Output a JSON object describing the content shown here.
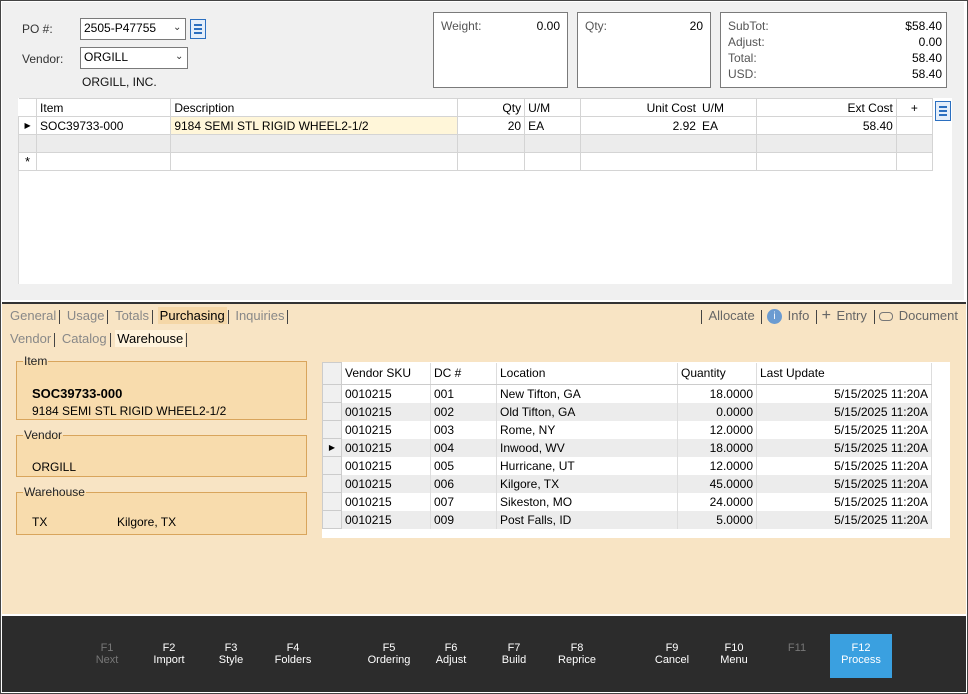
{
  "header": {
    "po_label": "PO #:",
    "po_value": "2505-P47755",
    "vendor_label": "Vendor:",
    "vendor_value": "ORGILL",
    "vendor_name": "ORGILL, INC."
  },
  "summary": {
    "weight_label": "Weight:",
    "weight_value": "0.00",
    "qty_label": "Qty:",
    "qty_value": "20",
    "subtot_label": "SubTot:",
    "subtot_value": "$58.40",
    "adjust_label": "Adjust:",
    "adjust_value": "0.00",
    "total_label": "Total:",
    "total_value": "58.40",
    "usd_label": "USD:",
    "usd_value": "58.40"
  },
  "lines": {
    "columns": [
      "Item",
      "Description",
      "Qty",
      "U/M",
      "Unit Cost",
      "U/M",
      "Ext Cost",
      "+"
    ],
    "rows": [
      {
        "item": "SOC39733-000",
        "description": "9184 SEMI STL RIGID WHEEL2-1/2",
        "qty": "20",
        "um": "EA",
        "unit_cost": "2.92",
        "um2": "EA",
        "ext_cost": "58.40"
      }
    ],
    "new_row_marker": "*"
  },
  "tabs": {
    "main": [
      "General",
      "Usage",
      "Totals",
      "Purchasing",
      "Inquiries"
    ],
    "active_main": "Purchasing",
    "actions": [
      "Allocate",
      "Info",
      "Entry",
      "Document"
    ],
    "sub": [
      "Vendor",
      "Catalog",
      "Warehouse"
    ],
    "active_sub": "Warehouse"
  },
  "item_panel": {
    "legend": "Item",
    "code": "SOC39733-000",
    "description": "9184 SEMI STL RIGID WHEEL2-1/2"
  },
  "vendor_panel": {
    "legend": "Vendor",
    "value": "ORGILL"
  },
  "warehouse_panel": {
    "legend": "Warehouse",
    "code": "TX",
    "city": "Kilgore, TX"
  },
  "warehouse_table": {
    "columns": [
      "Vendor SKU",
      "DC #",
      "Location",
      "Quantity",
      "Last Update"
    ],
    "rows": [
      {
        "sku": "0010215",
        "dc": "001",
        "location": "New Tifton, GA",
        "quantity": "18.0000",
        "last_update": "5/15/2025 11:20A"
      },
      {
        "sku": "0010215",
        "dc": "002",
        "location": "Old Tifton, GA",
        "quantity": "0.0000",
        "last_update": "5/15/2025 11:20A"
      },
      {
        "sku": "0010215",
        "dc": "003",
        "location": "Rome, NY",
        "quantity": "12.0000",
        "last_update": "5/15/2025 11:20A"
      },
      {
        "sku": "0010215",
        "dc": "004",
        "location": "Inwood, WV",
        "quantity": "18.0000",
        "last_update": "5/15/2025 11:20A"
      },
      {
        "sku": "0010215",
        "dc": "005",
        "location": "Hurricane, UT",
        "quantity": "12.0000",
        "last_update": "5/15/2025 11:20A"
      },
      {
        "sku": "0010215",
        "dc": "006",
        "location": "Kilgore, TX",
        "quantity": "45.0000",
        "last_update": "5/15/2025 11:20A"
      },
      {
        "sku": "0010215",
        "dc": "007",
        "location": "Sikeston, MO",
        "quantity": "24.0000",
        "last_update": "5/15/2025 11:20A"
      },
      {
        "sku": "0010215",
        "dc": "009",
        "location": "Post Falls, ID",
        "quantity": "5.0000",
        "last_update": "5/15/2025 11:20A"
      }
    ],
    "current_row": 3
  },
  "fkeys": [
    {
      "key": "F1",
      "label": "Next",
      "enabled": false
    },
    {
      "key": "F2",
      "label": "Import",
      "enabled": true
    },
    {
      "key": "F3",
      "label": "Style",
      "enabled": true
    },
    {
      "key": "F4",
      "label": "Folders",
      "enabled": true
    },
    {
      "key": "F5",
      "label": "Ordering",
      "enabled": true
    },
    {
      "key": "F6",
      "label": "Adjust",
      "enabled": true
    },
    {
      "key": "F7",
      "label": "Build",
      "enabled": true
    },
    {
      "key": "F8",
      "label": "Reprice",
      "enabled": true
    },
    {
      "key": "F9",
      "label": "Cancel",
      "enabled": true
    },
    {
      "key": "F10",
      "label": "Menu",
      "enabled": true
    },
    {
      "key": "F11",
      "label": "",
      "enabled": false
    },
    {
      "key": "F12",
      "label": "Process",
      "enabled": true
    }
  ],
  "colors": {
    "panel_bg": "#f8e4c4",
    "fieldset_bg": "#f8dcad",
    "fkey_bar": "#2c2c2c",
    "process_highlight": "#3aa0e0",
    "selected_cell": "#fff6d9"
  },
  "icons": [
    "menu-icon",
    "dropdown-arrow-icon",
    "info-icon",
    "plus-icon",
    "document-icon",
    "row-pointer-icon"
  ]
}
